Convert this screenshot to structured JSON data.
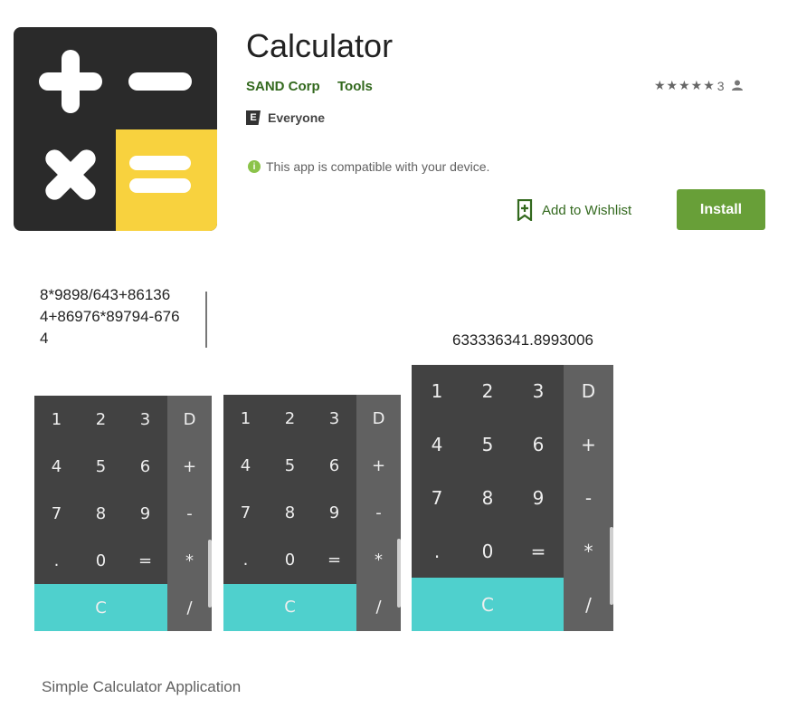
{
  "app": {
    "title": "Calculator",
    "developer": "SAND Corp",
    "category": "Tools",
    "rating_count": "3",
    "content_rating": "Everyone",
    "content_rating_badge": "E",
    "compatibility": "This app is compatible with your device.",
    "wishlist_label": "Add to Wishlist",
    "install_label": "Install",
    "description": "Simple Calculator Application"
  },
  "colors": {
    "accent_green": "#689f38",
    "link_green": "#33691e",
    "pad_dark": "#424242",
    "pad_side": "#616161",
    "pad_cyan": "#4fd0cd",
    "icon_yellow": "#f8d23e"
  },
  "screenshots": {
    "expression": "8*9898/643+86136\n4+86976*89794-676\n4",
    "result": "633336341.8993006",
    "keys": [
      "1",
      "2",
      "3",
      "D",
      "4",
      "5",
      "6",
      "+",
      "7",
      "8",
      "9",
      "-",
      ".",
      "0",
      "=",
      "*",
      "C",
      "/"
    ]
  }
}
